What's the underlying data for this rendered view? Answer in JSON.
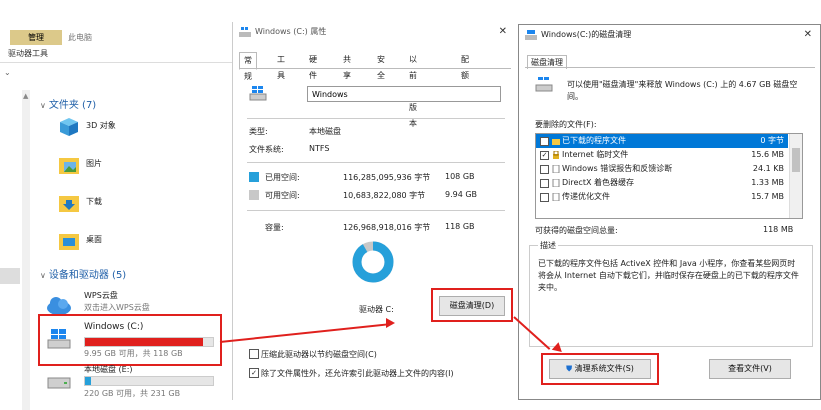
{
  "explorer": {
    "ribbon_manage": "管理",
    "ribbon_thispc": "此电脑",
    "drive_tools": "驱动器工具",
    "folders_section": "文件夹 (7)",
    "folders": [
      {
        "label": "3D 对象"
      },
      {
        "label": "图片"
      },
      {
        "label": "下载"
      },
      {
        "label": "桌面"
      }
    ],
    "devices_section": "设备和驱动器 (5)",
    "drives": [
      {
        "name": "WPS云盘",
        "caption": "双击进入WPS云盘",
        "fill": 0,
        "color": ""
      },
      {
        "name": "Windows (C:)",
        "caption": "9.95 GB 可用，共 118 GB",
        "fill": 0.92,
        "color": "#e0201d"
      },
      {
        "name": "本地磁盘 (E:)",
        "caption": "220 GB 可用，共 231 GB",
        "fill": 0.05,
        "color": "#26a0da"
      }
    ]
  },
  "props": {
    "title": "Windows (C:) 属性",
    "tabs": [
      "常规",
      "工具",
      "硬件",
      "共享",
      "安全",
      "以前的版本",
      "配额"
    ],
    "volume_name": "Windows",
    "type_label": "类型:",
    "type_value": "本地磁盘",
    "fs_label": "文件系统:",
    "fs_value": "NTFS",
    "used_label": "已用空间:",
    "used_bytes": "116,285,095,936 字节",
    "used_gb": "108 GB",
    "free_label": "可用空间:",
    "free_bytes": "10,683,822,080 字节",
    "free_gb": "9.94 GB",
    "cap_label": "容量:",
    "cap_bytes": "126,968,918,016 字节",
    "cap_gb": "118 GB",
    "used_fraction": 0.916,
    "drive_label": "驱动器 C:",
    "cleanup_button": "磁盘清理(D)",
    "compress_label": "压缩此驱动器以节约磁盘空间(C)",
    "index_label": "除了文件属性外，还允许索引此驱动器上文件的内容(I)",
    "colors": {
      "used": "#26a0da",
      "free": "#c8c8c8"
    }
  },
  "cleanup": {
    "title": "Windows(C:)的磁盘清理",
    "tab": "磁盘清理",
    "intro": "可以使用\"磁盘清理\"来释放 Windows (C:) 上的 4.67 GB 磁盘空间。",
    "files_label": "要删除的文件(F):",
    "files": [
      {
        "name": "已下载的程序文件",
        "size": "0 字节",
        "checked": true,
        "selected": true
      },
      {
        "name": "Internet 临时文件",
        "size": "15.6 MB",
        "checked": true,
        "selected": false
      },
      {
        "name": "Windows 错误报告和反馈诊断",
        "size": "24.1 KB",
        "checked": false,
        "selected": false
      },
      {
        "name": "DirectX 着色器缓存",
        "size": "1.33 MB",
        "checked": false,
        "selected": false
      },
      {
        "name": "传递优化文件",
        "size": "15.7 MB",
        "checked": false,
        "selected": false
      }
    ],
    "gain_label": "可获得的磁盘空间总量:",
    "gain_value": "118 MB",
    "desc_label": "描述",
    "desc_text": "已下载的程序文件包括 ActiveX 控件和 Java 小程序，你查看某些网页时将会从 Internet 自动下载它们，并临时保存在硬盘上的已下载的程序文件夹中。",
    "clean_system_button": "清理系统文件(S)",
    "view_files_button": "查看文件(V)"
  }
}
